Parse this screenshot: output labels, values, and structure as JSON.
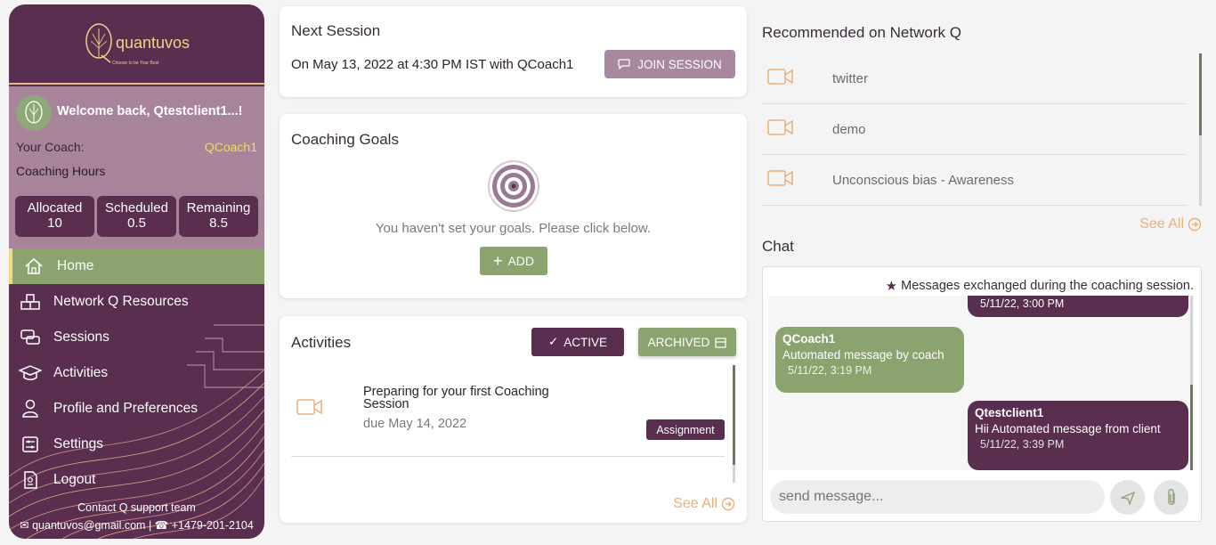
{
  "brand": {
    "name": "quantuvos",
    "tagline": "Choose to be Your Best"
  },
  "profile": {
    "welcome": "Welcome back, Qtestclient1...!",
    "coach_label": "Your Coach:",
    "coach_name": "QCoach1",
    "hours_label": "Coaching Hours",
    "hours": [
      {
        "label": "Allocated",
        "value": "10"
      },
      {
        "label": "Scheduled",
        "value": "0.5"
      },
      {
        "label": "Remaining",
        "value": "8.5"
      }
    ]
  },
  "nav": [
    {
      "label": "Home",
      "icon": "home-icon",
      "active": true
    },
    {
      "label": "Network Q Resources",
      "icon": "network-icon"
    },
    {
      "label": "Sessions",
      "icon": "chat-bubbles-icon"
    },
    {
      "label": "Activities",
      "icon": "graduation-cap-icon"
    },
    {
      "label": "Profile and Preferences",
      "icon": "user-icon"
    },
    {
      "label": "Settings",
      "icon": "sliders-icon"
    },
    {
      "label": "Logout",
      "icon": "logout-icon"
    }
  ],
  "contact": {
    "title": "Contact Q support team",
    "email": "quantuvos@gmail.com",
    "phone": "+1479-201-2104"
  },
  "next_session": {
    "title": "Next Session",
    "text": "On May 13, 2022 at 4:30 PM IST with QCoach1",
    "join_label": "JOIN SESSION"
  },
  "goals": {
    "title": "Coaching Goals",
    "empty_text": "You haven't set your goals. Please click below.",
    "add_label": "ADD"
  },
  "activities": {
    "title": "Activities",
    "active_label": "ACTIVE",
    "archived_label": "ARCHIVED",
    "items": [
      {
        "title_line1": "Preparing for your first Coaching",
        "title_line2": "Session",
        "due": "due May 14, 2022",
        "badge": "Assignment"
      }
    ],
    "see_all": "See All"
  },
  "recommended": {
    "title": "Recommended on Network Q",
    "items": [
      "twitter",
      "demo",
      "Unconscious bias - Awareness"
    ],
    "see_all": "See All"
  },
  "chat": {
    "title": "Chat",
    "note": "Messages exchanged during the coaching session.",
    "messages": [
      {
        "sender": "",
        "text": "",
        "time": "5/11/22, 3:00 PM"
      },
      {
        "sender": "QCoach1",
        "text": "Automated message by coach",
        "time": "5/11/22, 3:19 PM"
      },
      {
        "sender": "Qtestclient1",
        "text": "Hii Automated message from client",
        "time": "5/11/22, 3:39 PM"
      }
    ],
    "input_placeholder": "send message..."
  },
  "colors": {
    "primary": "#5a2e4e",
    "green": "#8aa36f",
    "accent": "#e8b07a",
    "gold": "#e8d58a"
  }
}
